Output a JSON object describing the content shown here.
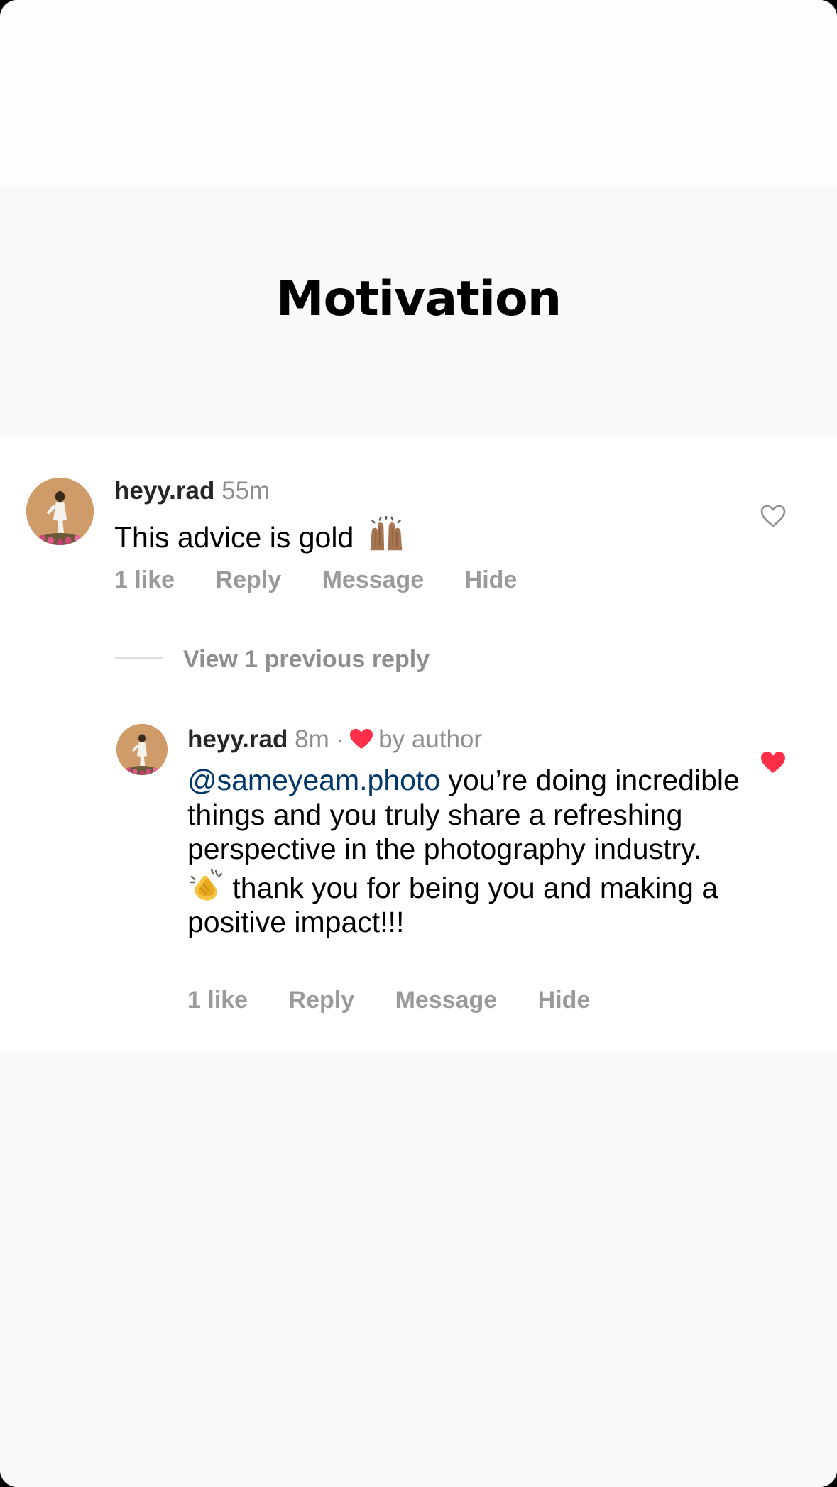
{
  "card": {
    "title": "Motivation"
  },
  "comment": {
    "username": "heyy.rad",
    "time": "55m",
    "text": "This advice is gold",
    "emoji": "raising-hands-emoji",
    "actions": {
      "likes": "1 like",
      "reply": "Reply",
      "message": "Message",
      "hide": "Hide"
    },
    "liked": false
  },
  "view_previous": "View 1 previous reply",
  "reply": {
    "username": "heyy.rad",
    "time": "8m",
    "separator": "·",
    "author_badge": "by author",
    "mention": "@sameyeam.photo",
    "text_part1": " you’re doing incredible things and you truly share a refreshing perspective in the photography industry. ",
    "emoji": "clapping-hands-emoji",
    "text_part2": " thank you for being you and making a positive impact!!!",
    "actions": {
      "likes": "1 like",
      "reply": "Reply",
      "message": "Message",
      "hide": "Hide"
    },
    "liked": true
  },
  "colors": {
    "heart_red": "#ff2f4a",
    "mention_blue": "#00376b",
    "secondary_gray": "#8e8e8e"
  }
}
